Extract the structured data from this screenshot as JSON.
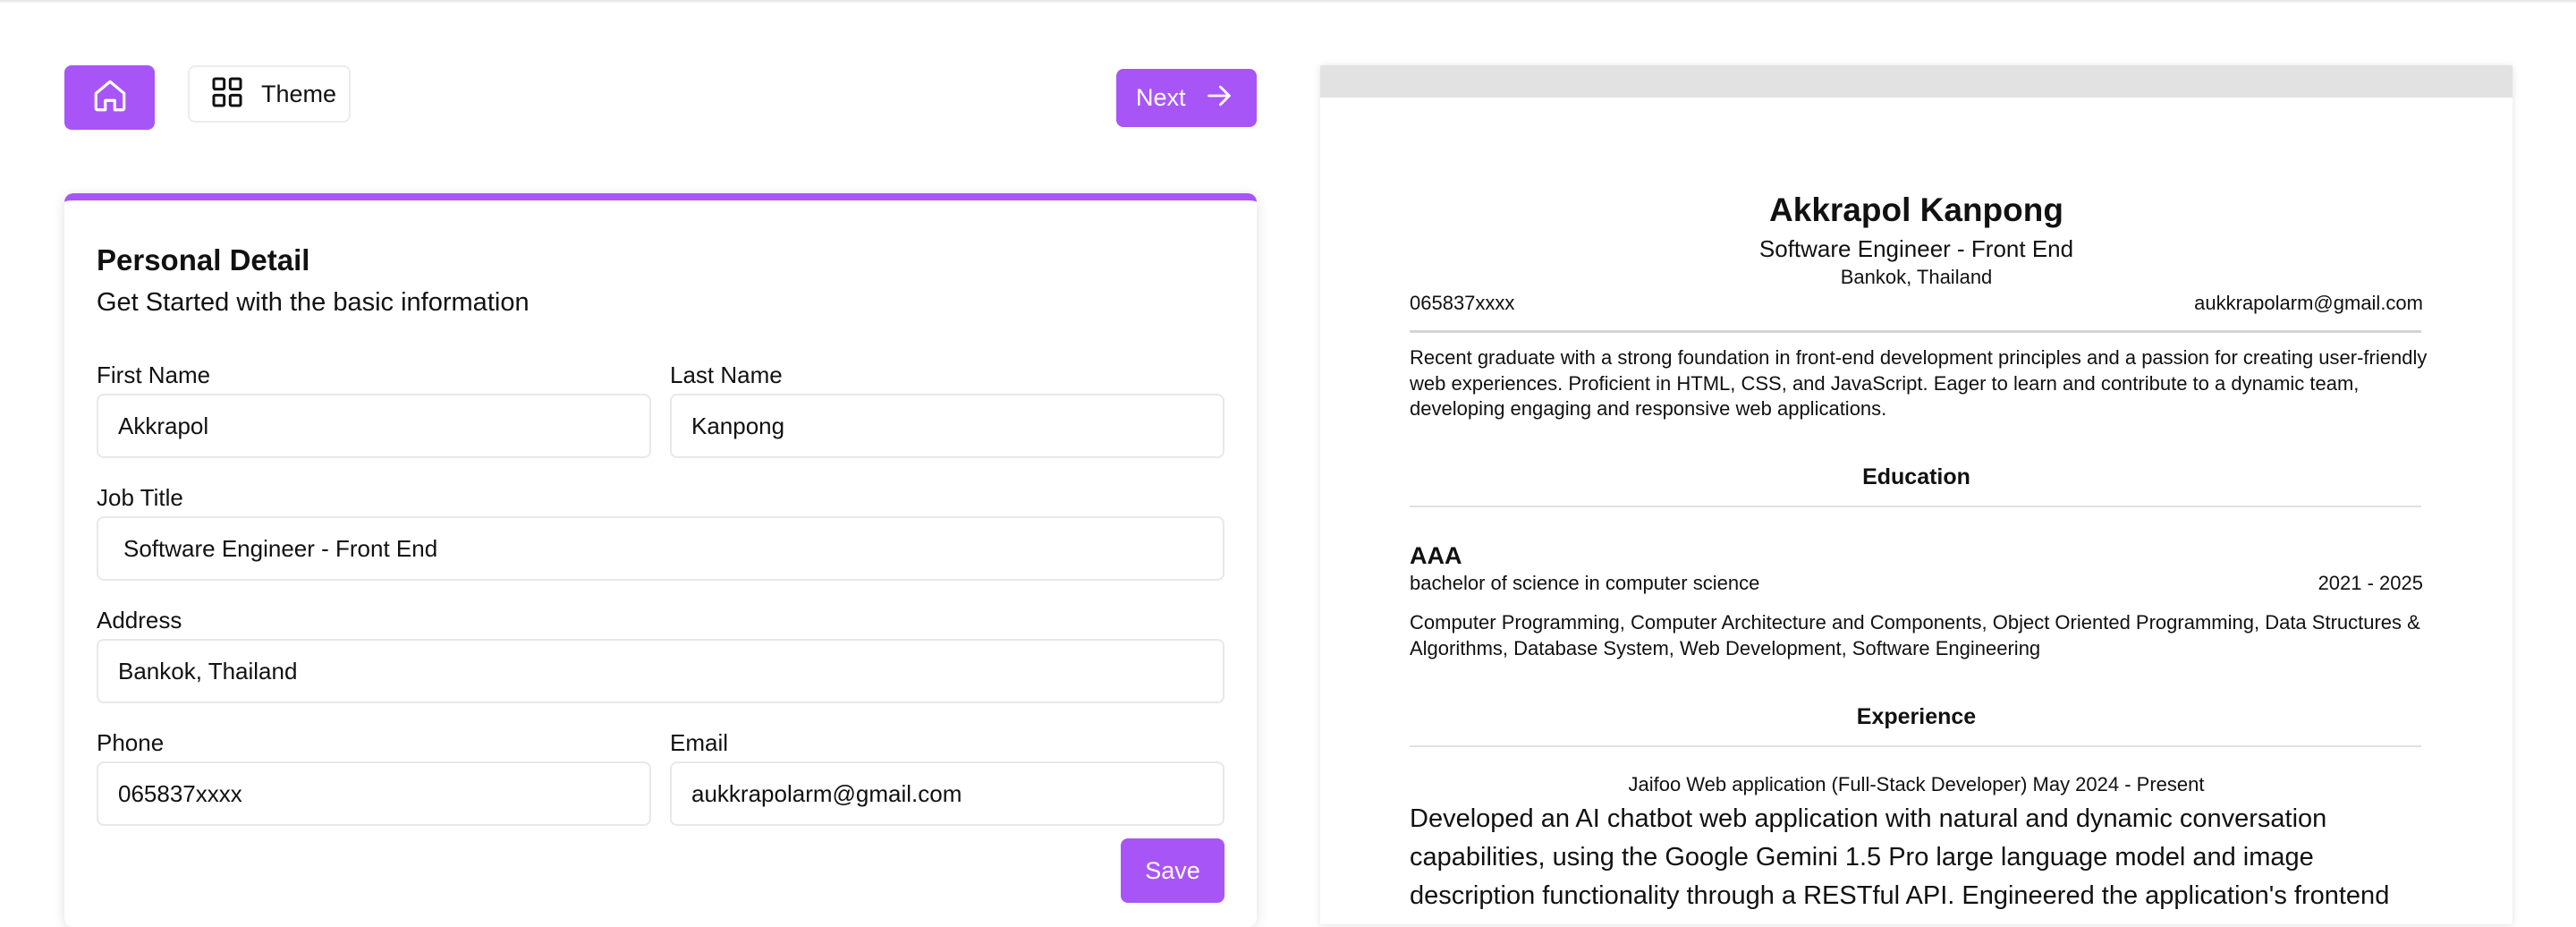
{
  "toolbar": {
    "home_icon": "home-icon",
    "theme_icon": "layout-grid-icon",
    "theme_label": "Theme",
    "next_label": "Next",
    "next_icon": "arrow-right-icon",
    "accent_color": "#a855f7"
  },
  "form": {
    "title": "Personal Detail",
    "subtitle": "Get Started with the basic information",
    "fields": {
      "first_name": {
        "label": "First Name",
        "value": "Akkrapol"
      },
      "last_name": {
        "label": "Last Name",
        "value": "Kanpong"
      },
      "job_title": {
        "label": "Job Title",
        "value": "Software Engineer - Front End"
      },
      "address": {
        "label": "Address",
        "value": "Bankok, Thailand"
      },
      "phone": {
        "label": "Phone",
        "value": "065837xxxx"
      },
      "email": {
        "label": "Email",
        "value": "aukkrapolarm@gmail.com"
      }
    },
    "save_label": "Save"
  },
  "preview": {
    "name": "Akkrapol Kanpong",
    "job_title": "Software Engineer - Front End",
    "address": "Bankok, Thailand",
    "phone": "065837xxxx",
    "email": "aukkrapolarm@gmail.com",
    "summary": "Recent graduate with a strong foundation in front-end development principles and a passion for creating user-friendly web experiences. Proficient in HTML, CSS, and JavaScript. Eager to learn and contribute to a dynamic team, developing engaging and responsive web applications.",
    "education_heading": "Education",
    "education": {
      "school": "AAA",
      "degree": "bachelor of science in computer science",
      "years": "2021 - 2025",
      "courses": "Computer Programming, Computer Architecture and Components, Object Oriented Programming, Data Structures & Algorithms, Database System, Web Development, Software Engineering"
    },
    "experience_heading": "Experience",
    "experience": {
      "heading": "Jaifoo Web application (Full-Stack Developer) May 2024 - Present",
      "description": "Developed an AI chatbot web application with natural and dynamic conversation capabilities, using the Google Gemini 1.5 Pro large language model and image description functionality through a RESTful API. Engineered the application's frontend"
    }
  }
}
